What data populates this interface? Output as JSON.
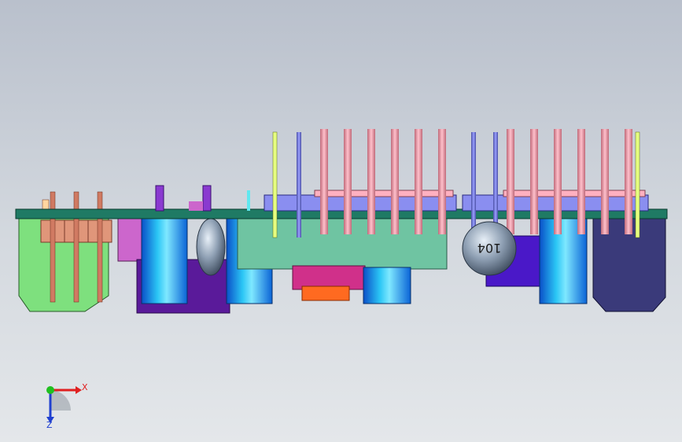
{
  "viewport": {
    "background_top": "#b9c0cc",
    "background_bottom": "#e4e7ea"
  },
  "model": {
    "capacitor_marking": "104"
  },
  "triad": {
    "x_label": "X",
    "z_label": "Z",
    "x_color": "#e02020",
    "y_color": "#20c020",
    "z_color": "#2040d0"
  }
}
